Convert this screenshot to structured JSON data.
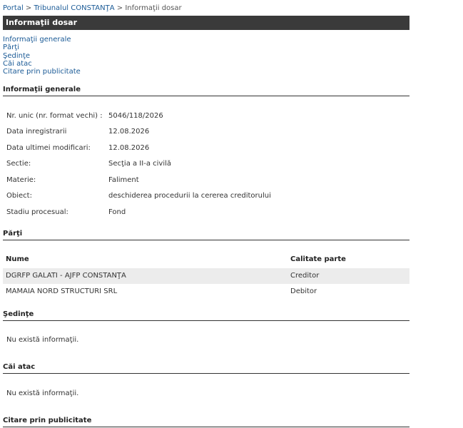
{
  "breadcrumb": {
    "items": [
      "Portal",
      "Tribunalul CONSTANŢA",
      "Informaţii dosar"
    ],
    "separator": ">"
  },
  "title": "Informaţii dosar",
  "toc": [
    "Informaţii generale",
    "Părţi",
    "Şedinţe",
    "Căi atac",
    "Citare prin publicitate"
  ],
  "general": {
    "heading": "Informaţii generale",
    "rows": [
      {
        "label": "Nr. unic (nr. format vechi) :",
        "value": "5046/118/2026"
      },
      {
        "label": "Data inregistrarii",
        "value": "12.08.2026"
      },
      {
        "label": "Data ultimei modificari:",
        "value": "12.08.2026"
      },
      {
        "label": "Sectie:",
        "value": "Secţia a II-a civilă"
      },
      {
        "label": "Materie:",
        "value": "Faliment"
      },
      {
        "label": "Obiect:",
        "value": "deschiderea procedurii la cererea creditorului"
      },
      {
        "label": "Stadiu procesual:",
        "value": "Fond"
      }
    ]
  },
  "parties": {
    "heading": "Părţi",
    "col_name": "Nume",
    "col_role": "Calitate parte",
    "rows": [
      {
        "name": "DGRFP GALATI - AJFP CONSTANŢA",
        "role": "Creditor"
      },
      {
        "name": "MAMAIA NORD STRUCTURI SRL",
        "role": "Debitor"
      }
    ]
  },
  "hearings": {
    "heading": "Şedinţe",
    "empty": "Nu există informaţii."
  },
  "appeals": {
    "heading": "Căi atac",
    "empty": "Nu există informaţii."
  },
  "summons": {
    "heading": "Citare prin publicitate"
  }
}
